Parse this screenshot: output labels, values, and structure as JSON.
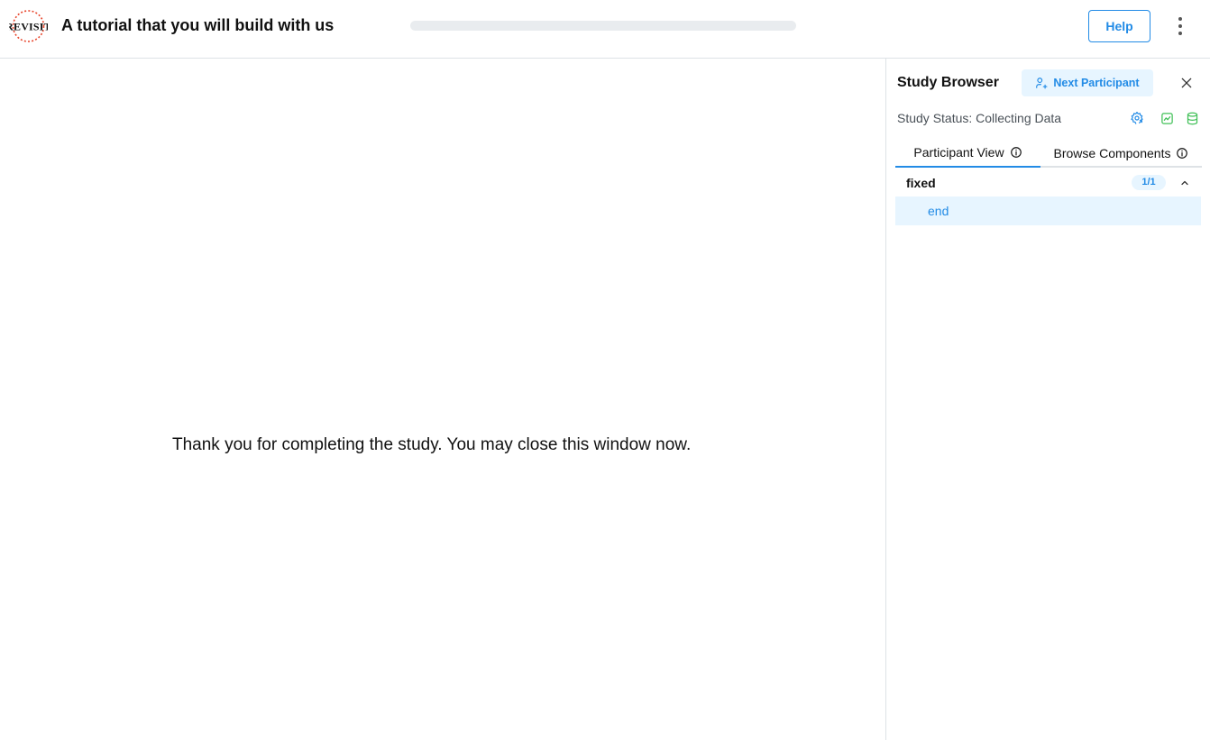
{
  "header": {
    "title": "A tutorial that you will build with us",
    "logo_text": "REVISIT",
    "progress": 0,
    "help_label": "Help",
    "menu_icon": "dots-vertical-icon"
  },
  "main": {
    "message": "Thank you for completing the study. You may close this window now."
  },
  "sidebar": {
    "title": "Study Browser",
    "next_participant_label": "Next Participant",
    "status_text": "Study Status: Collecting Data",
    "status_icons": [
      "settings-share-icon",
      "chart-area-icon",
      "database-icon"
    ],
    "tabs": [
      {
        "label": "Participant View",
        "active": true
      },
      {
        "label": "Browse Components",
        "active": false
      }
    ],
    "block": {
      "name": "fixed",
      "count": "1/1",
      "items": [
        {
          "label": "end",
          "selected": true
        }
      ]
    }
  },
  "colors": {
    "accent": "#228be6",
    "accent_light": "#e7f5ff",
    "status_green": "#40c057",
    "logo_red": "#e8452c"
  }
}
